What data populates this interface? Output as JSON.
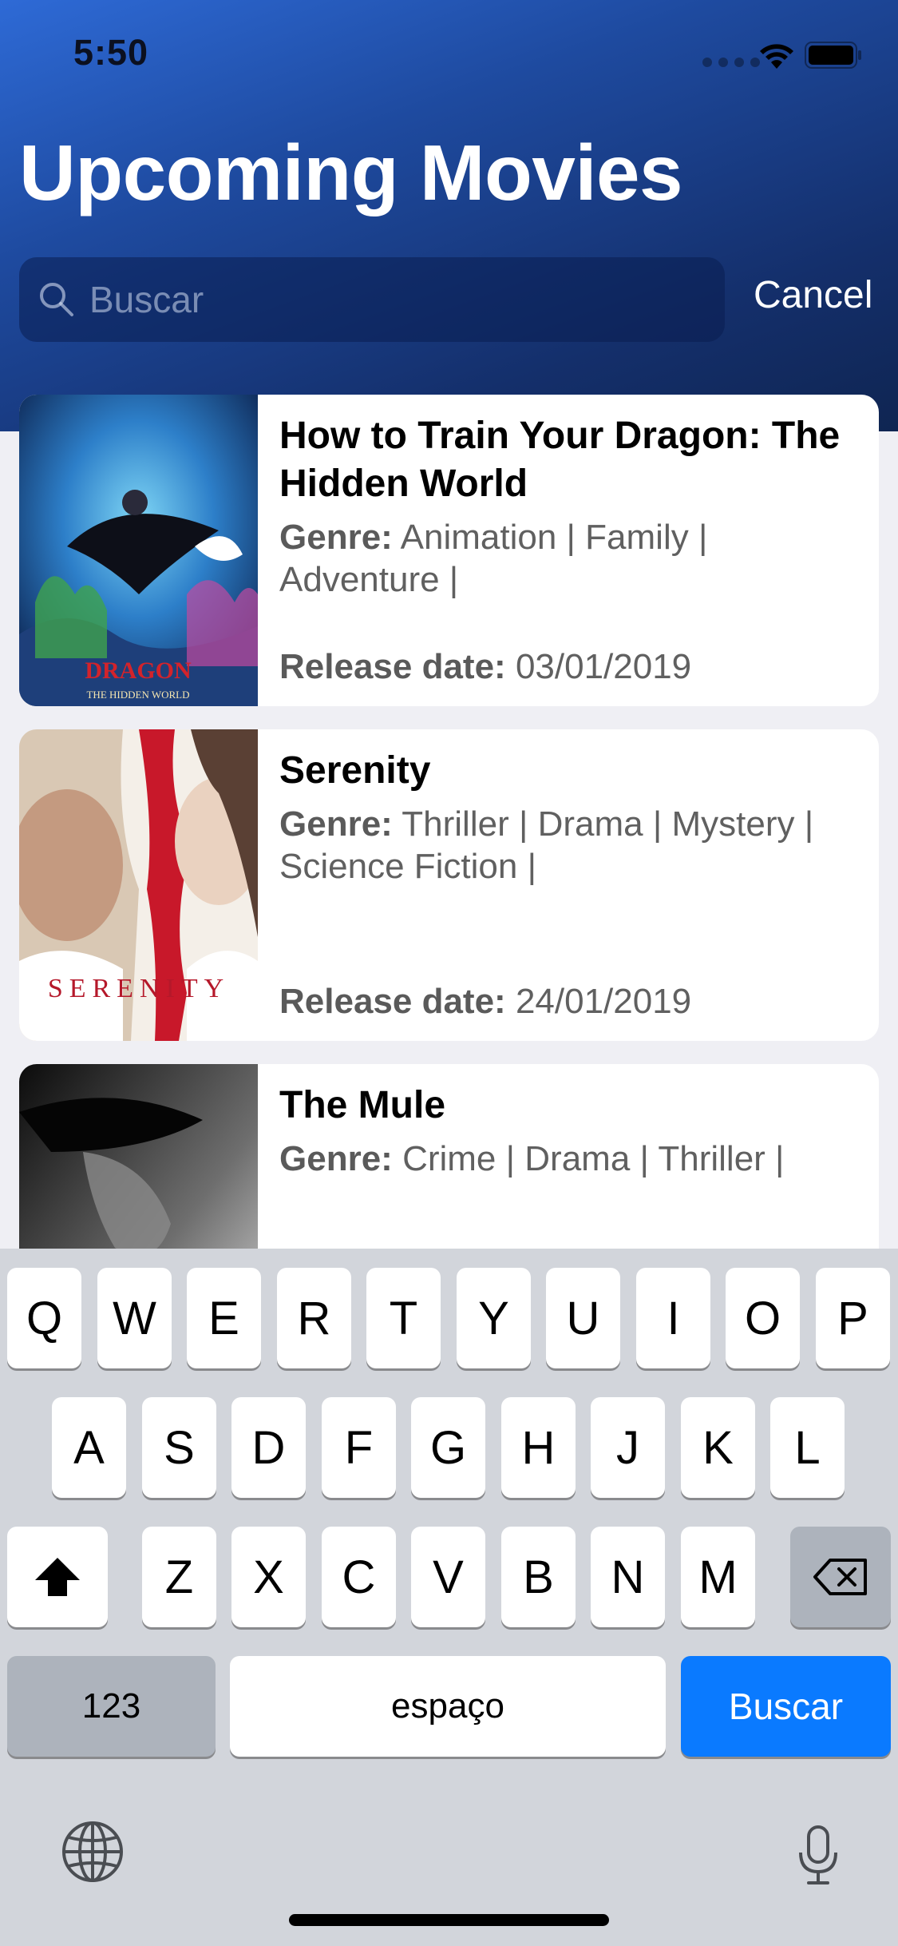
{
  "status_bar": {
    "time": "5:50"
  },
  "header": {
    "title": "Upcoming Movies"
  },
  "search": {
    "placeholder": "Buscar",
    "value": "",
    "cancel_label": "Cancel"
  },
  "movies": [
    {
      "title": "How to Train Your Dragon: The Hidden World",
      "genre_label": "Genre:",
      "genres": "Animation | Family | Adventure |",
      "release_label": "Release date:",
      "release_date": "03/01/2019",
      "poster_text": "DRAGON",
      "poster_subtext": "THE HIDDEN WORLD"
    },
    {
      "title": "Serenity",
      "genre_label": "Genre:",
      "genres": "Thriller | Drama | Mystery | Science Fiction |",
      "release_label": "Release date:",
      "release_date": "24/01/2019",
      "poster_text": "SERENITY"
    },
    {
      "title": "The Mule",
      "genre_label": "Genre:",
      "genres": "Crime | Drama | Thriller |"
    }
  ],
  "keyboard": {
    "row1": [
      "Q",
      "W",
      "E",
      "R",
      "T",
      "Y",
      "U",
      "I",
      "O",
      "P"
    ],
    "row2": [
      "A",
      "S",
      "D",
      "F",
      "G",
      "H",
      "J",
      "K",
      "L"
    ],
    "row3": [
      "Z",
      "X",
      "C",
      "V",
      "B",
      "N",
      "M"
    ],
    "numbers_label": "123",
    "space_label": "espaço",
    "return_label": "Buscar"
  },
  "colors": {
    "accent": "#0a7aff",
    "header_top": "#2e6ad6",
    "header_bottom": "#0f2552"
  }
}
